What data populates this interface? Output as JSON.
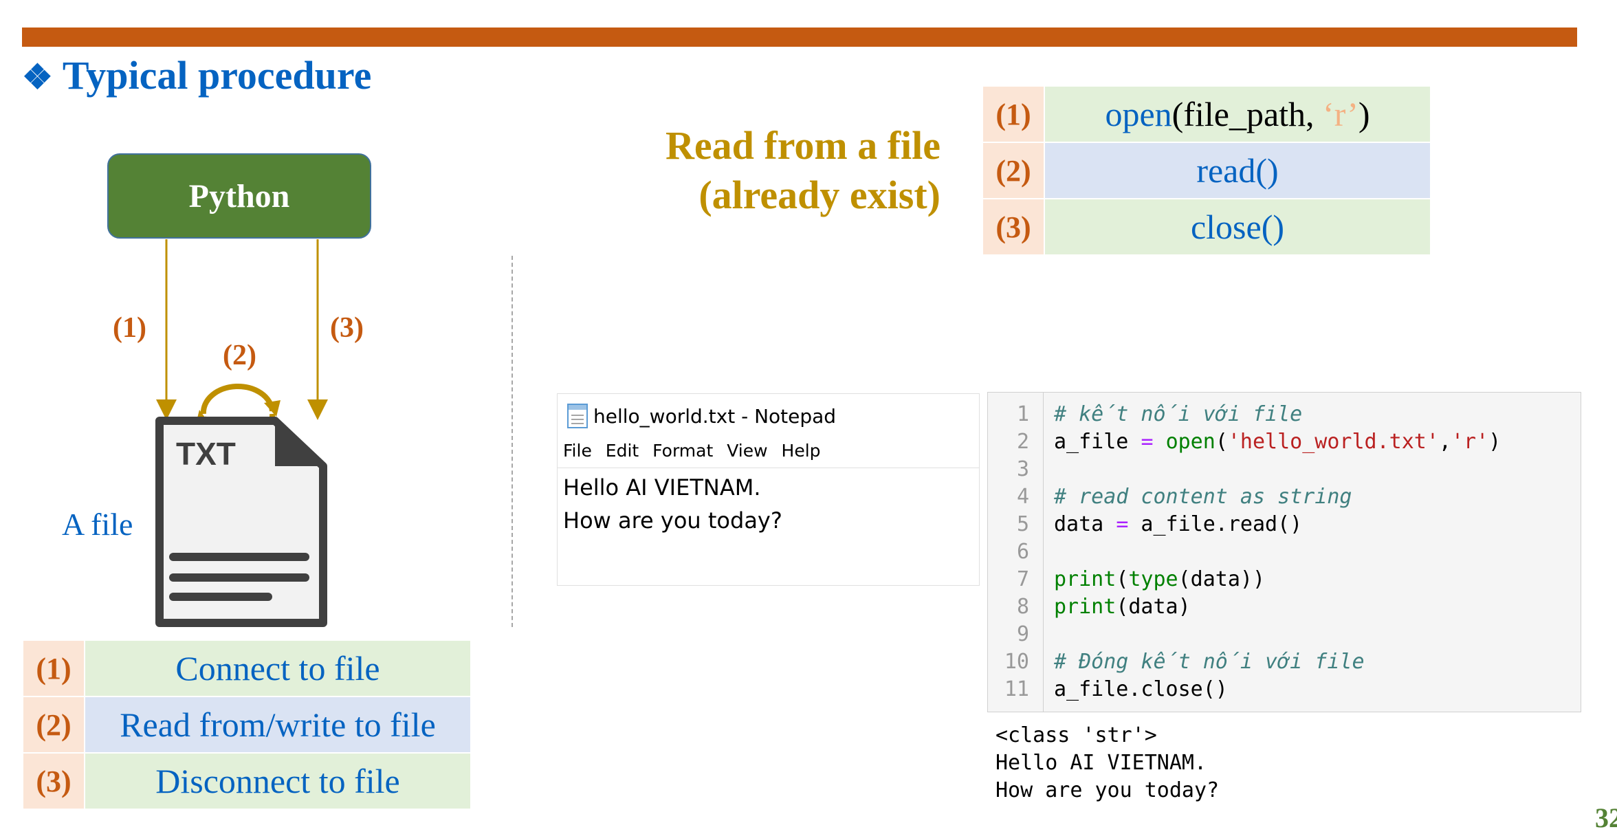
{
  "slide": {
    "heading": "Typical procedure",
    "page_number": "32"
  },
  "diagram": {
    "python_label": "Python",
    "step1_label": "(1)",
    "step2_label": "(2)",
    "step3_label": "(3)",
    "file_label": "A file",
    "file_icon_text": "TXT"
  },
  "read_section": {
    "title_line1": "Read from a file",
    "title_line2": "(already exist)",
    "rows": [
      {
        "num": "(1)",
        "parts": {
          "fn": "open",
          "lp": "(",
          "arg": "file_path, ",
          "mode": "‘r’",
          "rp": ")"
        }
      },
      {
        "num": "(2)",
        "text": "read()"
      },
      {
        "num": "(3)",
        "text": "close()"
      }
    ]
  },
  "legend": [
    {
      "num": "(1)",
      "text": "Connect to file"
    },
    {
      "num": "(2)",
      "text": "Read from/write to file"
    },
    {
      "num": "(3)",
      "text": "Disconnect to file"
    }
  ],
  "notepad": {
    "title": "hello_world.txt - Notepad",
    "menu": [
      "File",
      "Edit",
      "Format",
      "View",
      "Help"
    ],
    "lines": [
      "Hello AI VIETNAM.",
      "How are you today?"
    ]
  },
  "code": {
    "lines": [
      {
        "n": "1",
        "comment": "# kết nối với file"
      },
      {
        "n": "2",
        "a": "a_file ",
        "eq": "=",
        "b": " ",
        "fn": "open",
        "c": "(",
        "s1": "'hello_world.txt'",
        "d": ",",
        "s2": "'r'",
        "e": ")"
      },
      {
        "n": "3"
      },
      {
        "n": "4",
        "comment": "# read content as string"
      },
      {
        "n": "5",
        "a": "data ",
        "eq": "=",
        "b": " a_file.read()"
      },
      {
        "n": "6"
      },
      {
        "n": "7",
        "fn": "print",
        "c": "(",
        "fn2": "type",
        "d": "(data))"
      },
      {
        "n": "8",
        "fn": "print",
        "c": "(data)"
      },
      {
        "n": "9"
      },
      {
        "n": "10",
        "comment": "# Đóng kết nối với file"
      },
      {
        "n": "11",
        "a": "a_file.close()"
      }
    ]
  },
  "output": {
    "lines": [
      "<class 'str'>",
      "Hello AI VIETNAM.",
      "How are you today?"
    ]
  },
  "colors": {
    "accent_bar": "#c55a11",
    "heading": "#0563c1",
    "python_box": "#548235",
    "read_title": "#bf9000",
    "arrow": "#bf9000"
  }
}
